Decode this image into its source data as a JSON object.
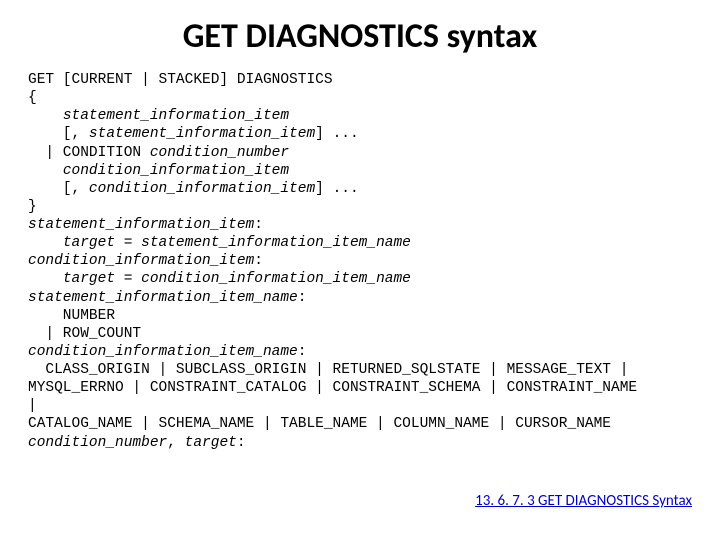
{
  "title": "GET DIAGNOSTICS syntax",
  "code": {
    "l1": "GET [CURRENT | STACKED] DIAGNOSTICS",
    "l2": "{",
    "l3a": "    ",
    "l3b": "statement_information_item",
    "l4a": "    [, ",
    "l4b": "statement_information_item",
    "l4c": "] ...",
    "l5a": "  | CONDITION ",
    "l5b": "condition_number",
    "l6a": "    ",
    "l6b": "condition_information_item",
    "l7a": "    [, ",
    "l7b": "condition_information_item",
    "l7c": "] ...",
    "l8": "}",
    "l9a": "statement_information_item",
    "l9b": ":",
    "l10a": "    ",
    "l10b": "target = statement_information_item_name",
    "l11a": "condition_information_item",
    "l11b": ":",
    "l12a": "    ",
    "l12b": "target = condition_information_item_name",
    "l13a": "statement_information_item_name",
    "l13b": ":",
    "l14": "    NUMBER",
    "l15": "  | ROW_COUNT",
    "l16a": "condition_information_item_name",
    "l16b": ":",
    "l17": "  CLASS_ORIGIN | SUBCLASS_ORIGIN | RETURNED_SQLSTATE | MESSAGE_TEXT |",
    "l18": "MYSQL_ERRNO | CONSTRAINT_CATALOG | CONSTRAINT_SCHEMA | CONSTRAINT_NAME",
    "l19": "|",
    "l20": "CATALOG_NAME | SCHEMA_NAME | TABLE_NAME | COLUMN_NAME | CURSOR_NAME",
    "l21a": "condition_number",
    "l21b": ", ",
    "l21c": "target",
    "l21d": ":"
  },
  "link": "13. 6. 7. 3 GET DIAGNOSTICS Syntax"
}
